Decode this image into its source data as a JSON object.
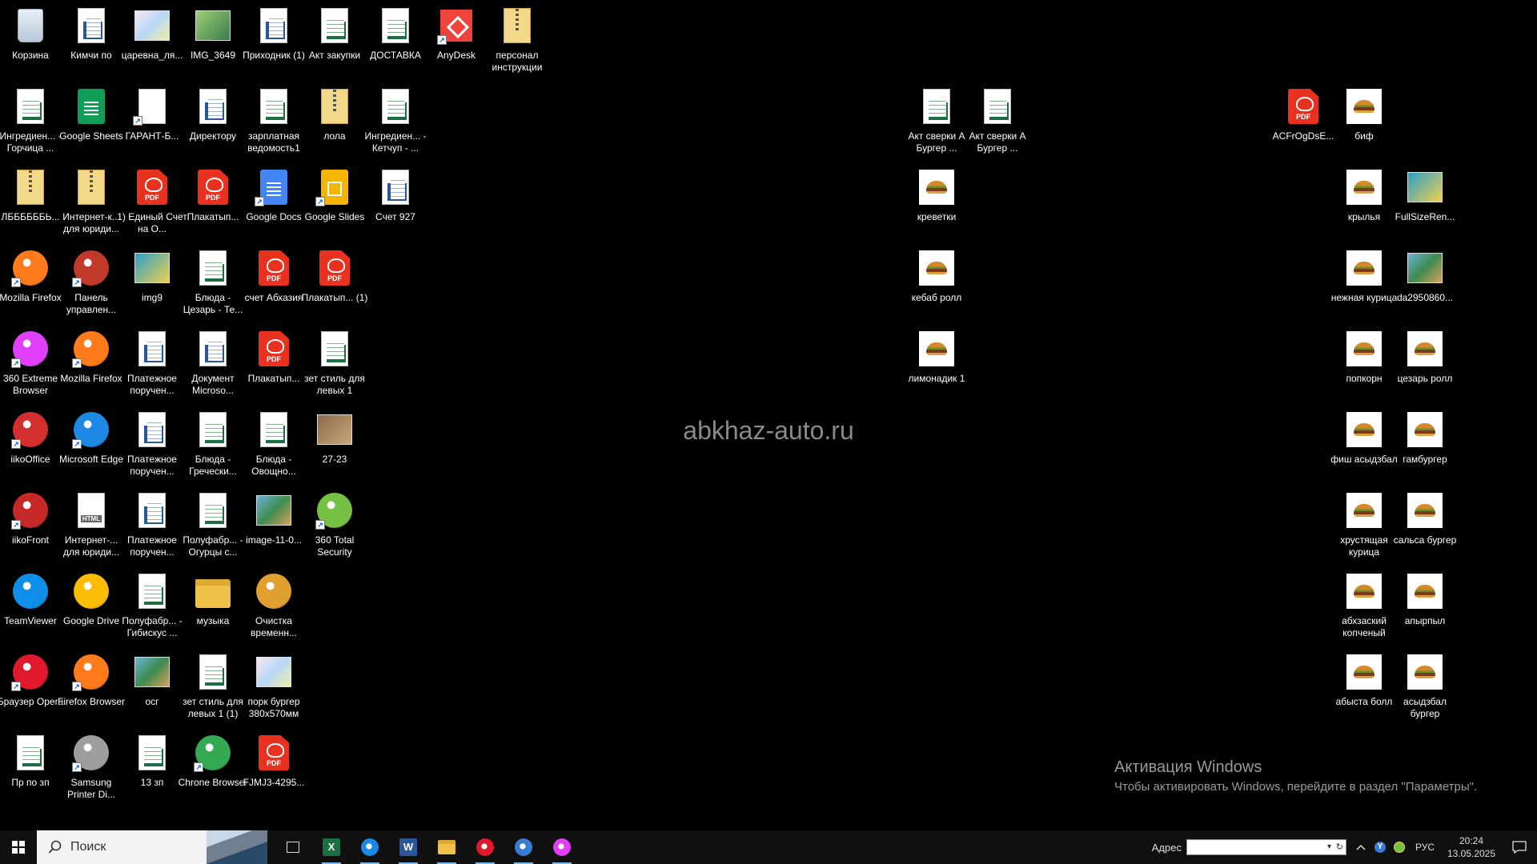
{
  "watermark": "abkhaz-auto.ru",
  "activation": {
    "title": "Активация Windows",
    "subtitle": "Чтобы активировать Windows, перейдите в раздел \"Параметры\"."
  },
  "icons": [
    {
      "label": "Корзина",
      "kind": "recycle",
      "icon": "recycle-bin-icon",
      "shortcut": false
    },
    {
      "label": "Кимчи по",
      "kind": "word",
      "icon": "word-document-icon",
      "shortcut": false
    },
    {
      "label": "царевна_ля...",
      "kind": "image",
      "icon": "image-file-icon",
      "shortcut": false
    },
    {
      "label": "IMG_3649",
      "kind": "image",
      "icon": "image-file-icon",
      "shortcut": false
    },
    {
      "label": "Приходник (1)",
      "kind": "word",
      "icon": "word-document-icon",
      "shortcut": false
    },
    {
      "label": "Акт закупки",
      "kind": "excel",
      "icon": "excel-spreadsheet-icon",
      "shortcut": false
    },
    {
      "label": "ДОСТАВКА",
      "kind": "excel",
      "icon": "excel-spreadsheet-icon",
      "shortcut": false
    },
    {
      "label": "AnyDesk",
      "kind": "anydesk",
      "icon": "anydesk-icon",
      "shortcut": true
    },
    {
      "label": "персонал инструкции",
      "kind": "zip",
      "icon": "archive-file-icon",
      "shortcut": false
    },
    {
      "label": "Ингредиен... - Горчица ...",
      "kind": "excel",
      "icon": "excel-spreadsheet-icon",
      "shortcut": false
    },
    {
      "label": "Google Sheets",
      "kind": "gsheets",
      "icon": "google-sheets-icon",
      "shortcut": false
    },
    {
      "label": "ГАРАНТ-Б...",
      "kind": "file",
      "icon": "blank-file-icon",
      "shortcut": true
    },
    {
      "label": "Директору",
      "kind": "word",
      "icon": "word-document-icon",
      "shortcut": false
    },
    {
      "label": "зарплатная ведомость1",
      "kind": "excel",
      "icon": "excel-spreadsheet-icon",
      "shortcut": false
    },
    {
      "label": "лола",
      "kind": "zip",
      "icon": "archive-file-icon",
      "shortcut": false
    },
    {
      "label": "Ингредиен... - Кетчуп - ...",
      "kind": "excel",
      "icon": "excel-spreadsheet-icon",
      "shortcut": false
    },
    {
      "label": "ЛББББББЬ...",
      "kind": "zip",
      "icon": "archive-file-icon",
      "shortcut": false
    },
    {
      "label": "Интернет-к... для юриди...",
      "kind": "zip",
      "icon": "archive-file-icon",
      "shortcut": false
    },
    {
      "label": "1) Единый Счет на О...",
      "kind": "pdf",
      "icon": "pdf-file-icon",
      "shortcut": false
    },
    {
      "label": "Плакатып...",
      "kind": "pdf",
      "icon": "pdf-file-icon",
      "shortcut": false
    },
    {
      "label": "Google Docs",
      "kind": "gdoc",
      "icon": "google-docs-icon",
      "shortcut": true
    },
    {
      "label": "Google Slides",
      "kind": "gslides",
      "icon": "google-slides-icon",
      "shortcut": true
    },
    {
      "label": "Счет 927",
      "kind": "word",
      "icon": "word-document-icon",
      "shortcut": false
    },
    {
      "label": "Mozilla Firefox",
      "kind": "app",
      "icon": "firefox-icon",
      "color": "#ff7a1a",
      "shortcut": true
    },
    {
      "label": "Панель управлен...",
      "kind": "app",
      "icon": "control-panel-icon",
      "color": "#c0392b",
      "shortcut": true
    },
    {
      "label": "img9",
      "kind": "image",
      "icon": "image-file-icon",
      "shortcut": false
    },
    {
      "label": "Блюда - Цезарь - Те...",
      "kind": "excel",
      "icon": "excel-spreadsheet-icon",
      "shortcut": false
    },
    {
      "label": "счет Абхазия",
      "kind": "pdf",
      "icon": "pdf-file-icon",
      "shortcut": false
    },
    {
      "label": "Плакатып... (1)",
      "kind": "pdf",
      "icon": "pdf-file-icon",
      "shortcut": false
    },
    {
      "label": "360 Extreme Browser",
      "kind": "app",
      "icon": "360-browser-icon",
      "color": "#e040fb",
      "shortcut": true
    },
    {
      "label": "Mozilla Firefox",
      "kind": "app",
      "icon": "firefox-icon",
      "color": "#ff7a1a",
      "shortcut": true
    },
    {
      "label": "Платежное поручен...",
      "kind": "word",
      "icon": "word-document-icon",
      "shortcut": false
    },
    {
      "label": "Документ Microso...",
      "kind": "word",
      "icon": "word-document-icon",
      "shortcut": false
    },
    {
      "label": "Плакатып...",
      "kind": "pdf",
      "icon": "pdf-file-icon",
      "shortcut": false
    },
    {
      "label": "зет стиль для левых 1",
      "kind": "excel",
      "icon": "excel-spreadsheet-icon",
      "shortcut": false
    },
    {
      "label": "iikoOffice",
      "kind": "app",
      "icon": "iikooffice-icon",
      "color": "#d32f2f",
      "shortcut": true
    },
    {
      "label": "Microsoft Edge",
      "kind": "app",
      "icon": "edge-icon",
      "color": "#1e88e5",
      "shortcut": true
    },
    {
      "label": "Платежное поручен...",
      "kind": "word",
      "icon": "word-document-icon",
      "shortcut": false
    },
    {
      "label": "Блюда - Гречески...",
      "kind": "excel",
      "icon": "excel-spreadsheet-icon",
      "shortcut": false
    },
    {
      "label": "Блюда - Овощно...",
      "kind": "excel",
      "icon": "excel-spreadsheet-icon",
      "shortcut": false
    },
    {
      "label": "27-23",
      "kind": "image",
      "icon": "image-file-icon",
      "shortcut": false
    },
    {
      "label": "iikoFront",
      "kind": "app",
      "icon": "iikofront-icon",
      "color": "#c62828",
      "shortcut": true
    },
    {
      "label": "Интернет-... для юриди...",
      "kind": "html",
      "icon": "html-file-icon",
      "shortcut": false
    },
    {
      "label": "Платежное поручен...",
      "kind": "word",
      "icon": "word-document-icon",
      "shortcut": false
    },
    {
      "label": "Полуфабр... - Огурцы с...",
      "kind": "excel",
      "icon": "excel-spreadsheet-icon",
      "shortcut": false
    },
    {
      "label": "image-11-0...",
      "kind": "image",
      "icon": "image-file-icon",
      "shortcut": false
    },
    {
      "label": "360 Total Security",
      "kind": "app",
      "icon": "360-security-icon",
      "color": "#76c043",
      "shortcut": true
    },
    {
      "label": "TeamViewer",
      "kind": "app",
      "icon": "teamviewer-icon",
      "color": "#0e8ee9",
      "shortcut": false
    },
    {
      "label": "Google Drive",
      "kind": "app",
      "icon": "google-drive-icon",
      "color": "#fbbc04",
      "shortcut": false
    },
    {
      "label": "Полуфабр... - Гибискус ...",
      "kind": "excel",
      "icon": "excel-spreadsheet-icon",
      "shortcut": false
    },
    {
      "label": "музыка",
      "kind": "folder",
      "icon": "folder-icon",
      "shortcut": false
    },
    {
      "label": "Очистка временн...",
      "kind": "app",
      "icon": "broom-icon",
      "color": "#e0a030",
      "shortcut": false
    },
    {
      "label": "Браузер Opera",
      "kind": "app",
      "icon": "opera-icon",
      "color": "#e0192d",
      "shortcut": true
    },
    {
      "label": "Firefox Browser",
      "kind": "app",
      "icon": "firefox-icon",
      "color": "#ff7a1a",
      "shortcut": true
    },
    {
      "label": "осг",
      "kind": "image",
      "icon": "image-file-icon",
      "shortcut": false
    },
    {
      "label": "зет стиль для левых 1 (1)",
      "kind": "excel",
      "icon": "excel-spreadsheet-icon",
      "shortcut": false
    },
    {
      "label": "порк бургер 380x570мм",
      "kind": "image",
      "icon": "image-file-icon",
      "shortcut": false
    },
    {
      "label": "Пр по зп",
      "kind": "excel",
      "icon": "excel-spreadsheet-icon",
      "shortcut": false
    },
    {
      "label": "Samsung Printer Di...",
      "kind": "app",
      "icon": "printer-icon",
      "color": "#9e9e9e",
      "shortcut": true
    },
    {
      "label": "13 зп",
      "kind": "excel",
      "icon": "excel-spreadsheet-icon",
      "shortcut": false
    },
    {
      "label": "Chrone Browser",
      "kind": "app",
      "icon": "chrome-icon",
      "color": "#34a853",
      "shortcut": true
    },
    {
      "label": "FJMJ3-4295...",
      "kind": "pdf",
      "icon": "pdf-file-icon",
      "shortcut": false
    },
    {
      "label": "Акт сверки А Бургер ...",
      "kind": "excel",
      "icon": "excel-spreadsheet-icon",
      "shortcut": false
    },
    {
      "label": "Акт сверки А Бургер ...",
      "kind": "excel",
      "icon": "excel-spreadsheet-icon",
      "shortcut": false
    },
    {
      "label": "креветки",
      "kind": "food",
      "icon": "food-image-icon",
      "shortcut": false
    },
    {
      "label": "кебаб ролл",
      "kind": "food",
      "icon": "food-image-icon",
      "shortcut": false
    },
    {
      "label": "лимонадик 1",
      "kind": "food",
      "icon": "food-image-icon",
      "shortcut": false
    },
    {
      "label": "ACFrOgDsE...",
      "kind": "pdf",
      "icon": "pdf-file-icon",
      "shortcut": false
    },
    {
      "label": "биф",
      "kind": "food",
      "icon": "food-image-icon",
      "shortcut": false
    },
    {
      "label": "крылья",
      "kind": "food",
      "icon": "food-image-icon",
      "shortcut": false
    },
    {
      "label": "FullSizeRen...",
      "kind": "image",
      "icon": "image-file-icon",
      "shortcut": false
    },
    {
      "label": "нежная курица",
      "kind": "food",
      "icon": "food-image-icon",
      "shortcut": false
    },
    {
      "label": "da2950860...",
      "kind": "image",
      "icon": "image-file-icon",
      "shortcut": false
    },
    {
      "label": "попкорн",
      "kind": "food",
      "icon": "food-image-icon",
      "shortcut": false
    },
    {
      "label": "цезарь ролл",
      "kind": "food",
      "icon": "food-image-icon",
      "shortcut": false
    },
    {
      "label": "фиш асыдзбал",
      "kind": "food",
      "icon": "food-image-icon",
      "shortcut": false
    },
    {
      "label": "гамбургер",
      "kind": "food",
      "icon": "food-image-icon",
      "shortcut": false
    },
    {
      "label": "хрустящая курица",
      "kind": "food",
      "icon": "food-image-icon",
      "shortcut": false
    },
    {
      "label": "сальса бургер",
      "kind": "food",
      "icon": "food-image-icon",
      "shortcut": false
    },
    {
      "label": "абхзаский копченый",
      "kind": "food",
      "icon": "food-image-icon",
      "shortcut": false
    },
    {
      "label": "апырпыл",
      "kind": "food",
      "icon": "food-image-icon",
      "shortcut": false
    },
    {
      "label": "абыста болл",
      "kind": "food",
      "icon": "food-image-icon",
      "shortcut": false
    },
    {
      "label": "асыдзбал бургер",
      "kind": "food",
      "icon": "food-image-icon",
      "shortcut": false
    }
  ],
  "taskbar": {
    "search_placeholder": "Поиск",
    "pinned": [
      {
        "name": "task-view-icon"
      },
      {
        "name": "excel-taskbar-icon"
      },
      {
        "name": "edge-taskbar-icon"
      },
      {
        "name": "word-taskbar-icon"
      },
      {
        "name": "file-explorer-taskbar-icon"
      },
      {
        "name": "opera-taskbar-icon"
      },
      {
        "name": "yandex-browser-taskbar-icon"
      },
      {
        "name": "360-browser-taskbar-icon"
      }
    ],
    "address_label": "Адрес",
    "address_value": "",
    "language": "РУС",
    "time": "20:24",
    "date": "13.05.2025"
  }
}
